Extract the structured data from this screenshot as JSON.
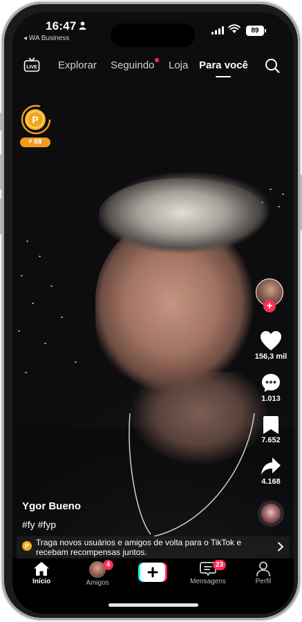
{
  "status_bar": {
    "time": "16:47",
    "back_app": "◂ WA Business",
    "battery": "89"
  },
  "top_nav": {
    "tabs": [
      {
        "label": "Explorar"
      },
      {
        "label": "Seguindo"
      },
      {
        "label": "Loja"
      },
      {
        "label": "Para você"
      }
    ],
    "active_tab": "Para você"
  },
  "coin": {
    "count": "88",
    "badge_prefix": "P"
  },
  "post": {
    "username": "Ygor Bueno",
    "hashtags": "#fy #fyp",
    "likes": "156,3 mil",
    "comments": "1.013",
    "saves": "7.652",
    "shares": "4.168"
  },
  "promo": {
    "text": "Traga novos usuários e amigos de volta para o TikTok e recebam recompensas juntos.",
    "icon_letter": "P"
  },
  "tab_bar": {
    "items": [
      {
        "label": "Início"
      },
      {
        "label": "Amigos",
        "badge": "4"
      },
      {
        "label": "Mensagens",
        "badge": "23"
      },
      {
        "label": "Perfil"
      }
    ]
  },
  "colors": {
    "accent": "#fe2c55",
    "coin": "#f39c1c",
    "background": "#000000"
  }
}
